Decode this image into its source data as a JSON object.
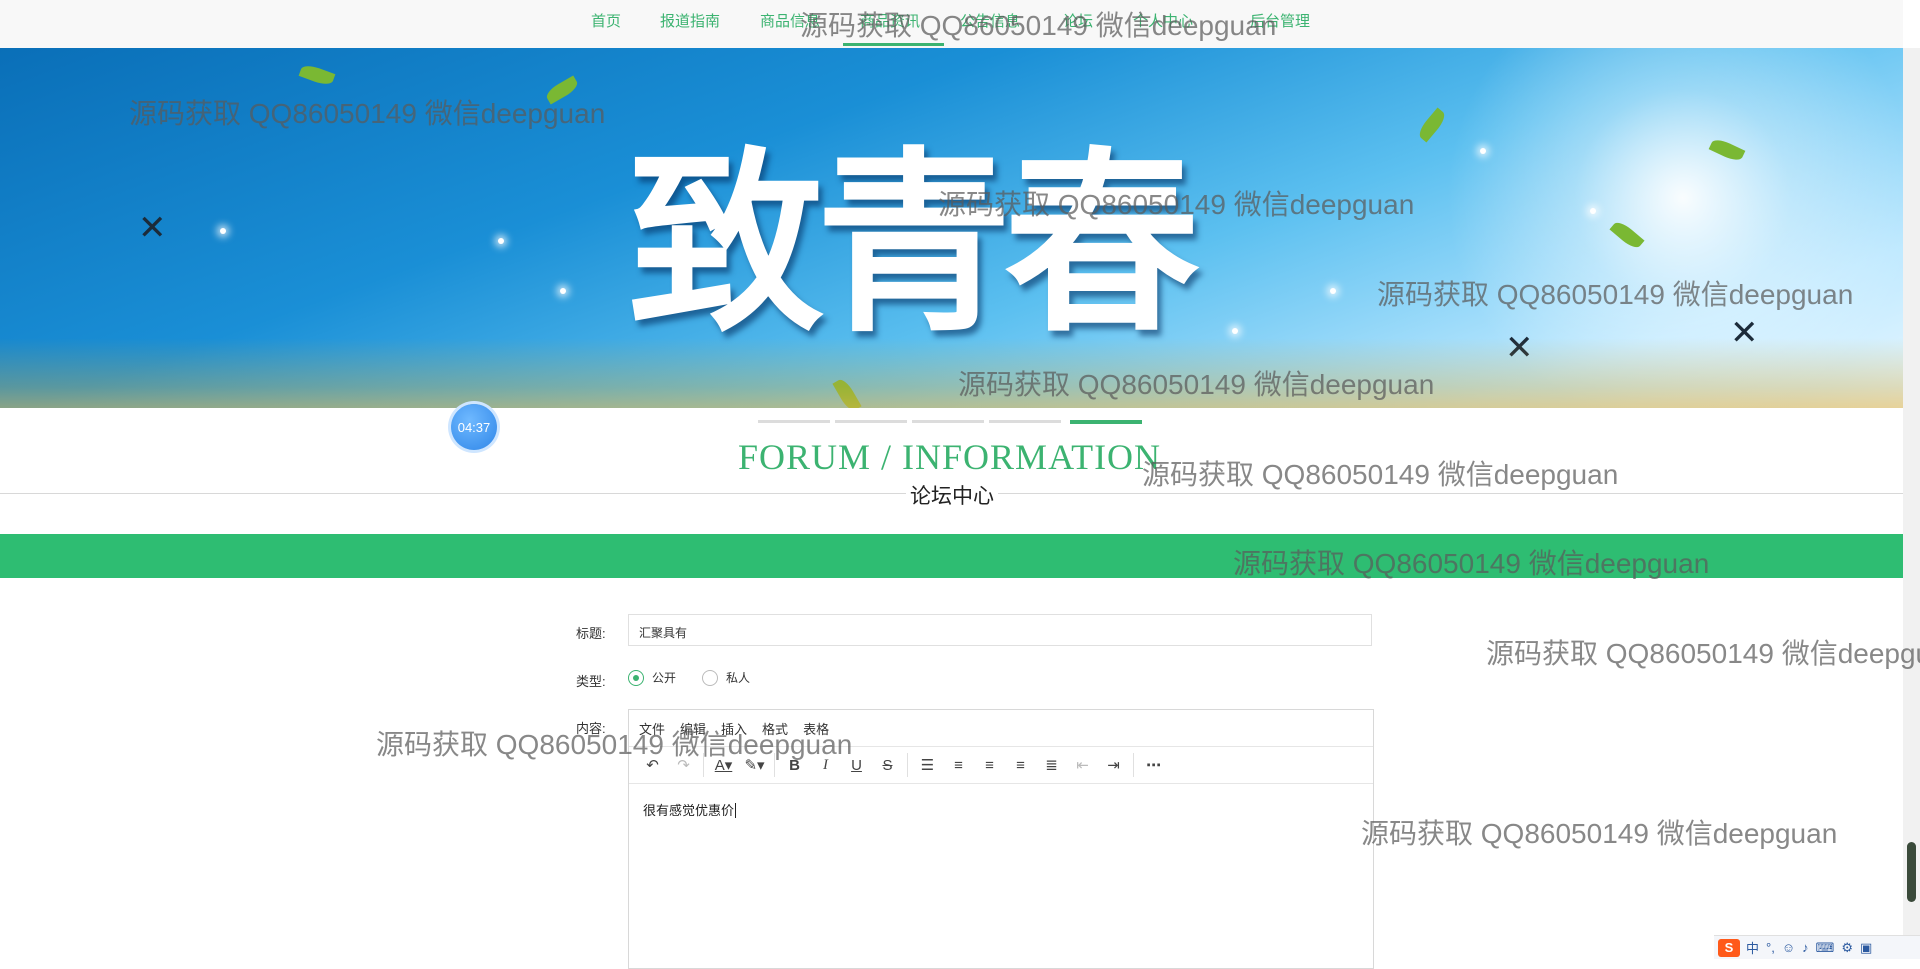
{
  "nav": {
    "items": [
      {
        "label": "首页"
      },
      {
        "label": "报道指南"
      },
      {
        "label": "商品信息"
      },
      {
        "label": "商品资讯"
      },
      {
        "label": "公告信息"
      },
      {
        "label": "论坛"
      },
      {
        "label": "个人中心"
      },
      {
        "label": "后台管理"
      }
    ]
  },
  "banner": {
    "title": "致青春"
  },
  "timer": "04:37",
  "section": {
    "title": "FORUM / INFORMATION",
    "subtitle": "论坛中心"
  },
  "form": {
    "title_label": "标题:",
    "title_value": "汇聚具有",
    "type_label": "类型:",
    "type_options": [
      "公开",
      "私人"
    ],
    "type_selected": "公开",
    "content_label": "内容:",
    "editor_menu": [
      "文件",
      "编辑",
      "插入",
      "格式",
      "表格"
    ],
    "editor_toolbar": [
      "undo-icon",
      "redo-icon",
      "text-color-icon",
      "highlight-icon",
      "bold-icon",
      "italic-icon",
      "underline-icon",
      "strikethrough-icon",
      "list-icon",
      "align-left-icon",
      "align-center-icon",
      "align-right-icon",
      "justify-icon",
      "outdent-icon",
      "indent-icon",
      "more-icon"
    ],
    "editor_text": "很有感觉优惠价"
  },
  "tray": {
    "ime": "中"
  },
  "watermark": "源码获取 QQ86050149 微信deepguan",
  "colors": {
    "accent": "#3cb371",
    "green_bar": "#2ebd72"
  }
}
